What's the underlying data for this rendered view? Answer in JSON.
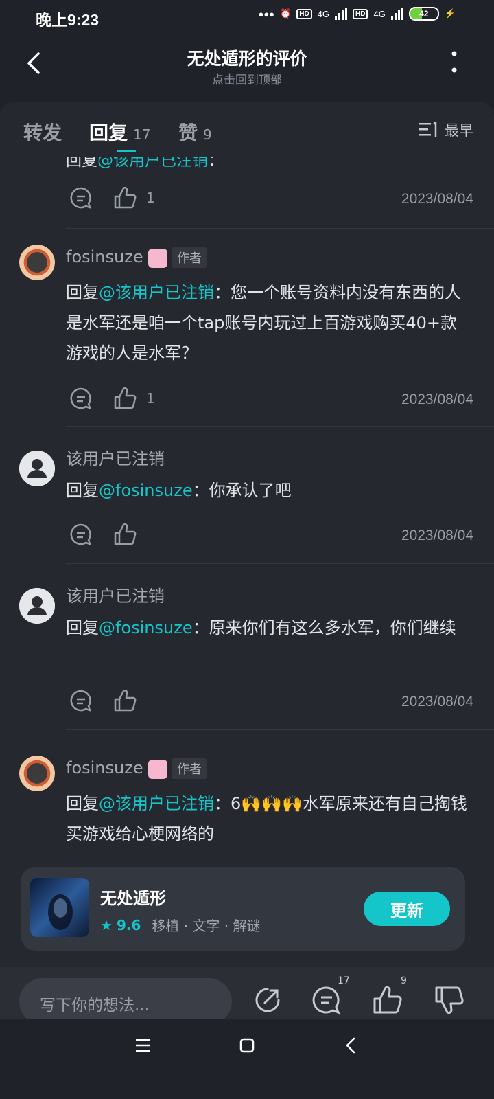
{
  "status_bar": {
    "time": "晚上9:23",
    "signal1": "4G",
    "signal2": "4G",
    "hd": "HD",
    "battery": "42"
  },
  "header": {
    "title": "无处遁形的评价",
    "subtitle": "点击回到顶部"
  },
  "tabs": [
    {
      "label": "转发",
      "count": ""
    },
    {
      "label": "回复",
      "count": "17"
    },
    {
      "label": "赞",
      "count": "9"
    }
  ],
  "sort_label": "最早",
  "partial_comment": {
    "prefix": "回复",
    "mention": "@该用户已注销",
    "text": "："
  },
  "comments": [
    {
      "like_count": "1",
      "date": "2023/08/04"
    },
    {
      "author": "fosinsuze",
      "tag": "作者",
      "prefix": "回复",
      "mention": "@该用户已注销",
      "text": "：您一个账号资料内没有东西的人是水军还是咱一个tap账号内玩过上百游戏购买40+款游戏的人是水军？",
      "like_count": "1",
      "date": "2023/08/04"
    },
    {
      "author": "该用户已注销",
      "prefix": "回复",
      "mention": "@fosinsuze",
      "text": "：你承认了吧",
      "like_count": "",
      "date": "2023/08/04"
    },
    {
      "author": "该用户已注销",
      "prefix": "回复",
      "mention": "@fosinsuze",
      "text": "：原来你们有这么多水军，你们继续",
      "like_count": "",
      "date": "2023/08/04"
    },
    {
      "author": "fosinsuze",
      "tag": "作者",
      "prefix": "回复",
      "mention": "@该用户已注销",
      "text": "：6🙌🙌🙌水军原来还有自己掏钱买游戏给心梗网络的"
    }
  ],
  "game_card": {
    "name": "无处遁形",
    "score": "9.6",
    "tags": "移植 · 文字 · 解谜",
    "button": "更新"
  },
  "bottom_bar": {
    "placeholder": "写下你的想法...",
    "reply_count": "17",
    "like_count": "9"
  },
  "colors": {
    "accent": "#14c5c9",
    "background": "#1f2229",
    "panel": "#25282f"
  }
}
